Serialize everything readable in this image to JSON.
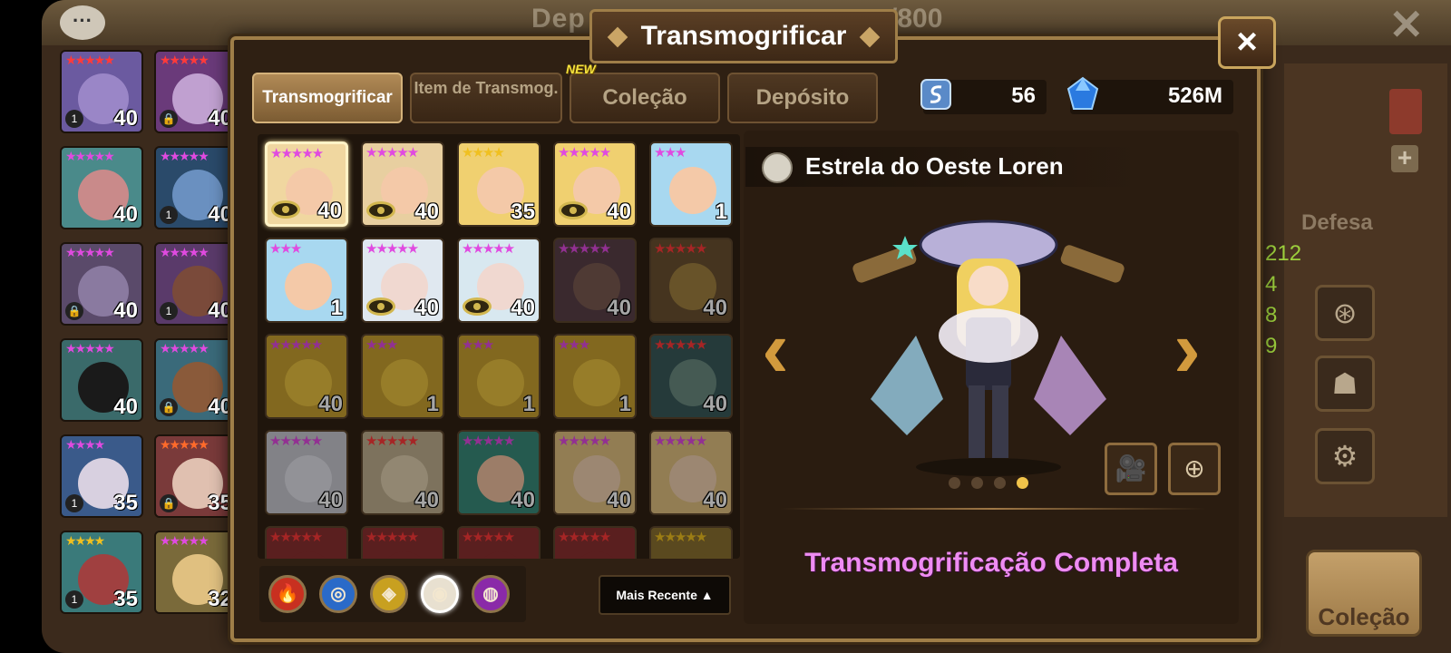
{
  "background": {
    "title_left": "Dep",
    "title_right": "/800",
    "defesa_label": "Defesa",
    "stats": [
      "212",
      "4",
      "8",
      "9"
    ],
    "collection_button": "Coleção",
    "monster_list_left": [
      {
        "stars": "★★★★★",
        "level": "40",
        "badge": "1",
        "color": "#6b5aa0",
        "face": "#9a86c7",
        "star_color": "#ff3a3a"
      },
      {
        "stars": "★★★★★",
        "level": "40",
        "badge": "",
        "color": "#4a8a8a",
        "face": "#c98a8a",
        "star_color": "#e04ae0"
      },
      {
        "stars": "★★★★★",
        "level": "40",
        "badge": "🔒",
        "color": "#5a4a6a",
        "face": "#8a7aa0",
        "star_color": "#e04ae0"
      },
      {
        "stars": "★★★★★",
        "level": "40",
        "badge": "",
        "color": "#3a6a6a",
        "face": "#1a1a1a",
        "star_color": "#e04ae0"
      },
      {
        "stars": "★★★★",
        "level": "35",
        "badge": "1",
        "color": "#3a5a8a",
        "face": "#d8d0e0",
        "star_color": "#e04ae0"
      },
      {
        "stars": "★★★★",
        "level": "35",
        "badge": "1",
        "color": "#3a7a7a",
        "face": "#a04040",
        "star_color": "#f0c020"
      }
    ],
    "monster_list_right": [
      {
        "stars": "★★★★★",
        "level": "40",
        "badge": "🔒",
        "color": "#6a3a7a",
        "face": "#c0a0d0",
        "star_color": "#ff3a3a"
      },
      {
        "stars": "★★★★★",
        "level": "40",
        "badge": "1",
        "color": "#2a4a6a",
        "face": "#6a90c0",
        "star_color": "#e04ae0"
      },
      {
        "stars": "★★★★★",
        "level": "40",
        "badge": "1",
        "color": "#5a3a6a",
        "face": "#7a4a3a",
        "star_color": "#e04ae0"
      },
      {
        "stars": "★★★★★",
        "level": "40",
        "badge": "🔒",
        "color": "#3a6a7a",
        "face": "#8a5a3a",
        "star_color": "#e04ae0"
      },
      {
        "stars": "★★★★★",
        "level": "35",
        "badge": "🔒",
        "color": "#7a3a3a",
        "face": "#e0c0b0",
        "star_color": "#ff6a2a"
      },
      {
        "stars": "★★★★★",
        "level": "32",
        "badge": "",
        "color": "#7a6a3a",
        "face": "#e0c080",
        "star_color": "#e04ae0"
      }
    ]
  },
  "modal": {
    "title": "Transmogrificar",
    "close_label": "×",
    "tabs": [
      {
        "label": "Transmogrificar",
        "active": true
      },
      {
        "label": "Item de Transmog.",
        "active": false
      },
      {
        "label": "Coleção",
        "active": false
      },
      {
        "label": "Depósito",
        "active": false
      }
    ],
    "new_badge": "NEW",
    "currency": [
      {
        "icon": "transmog-stone-icon",
        "value": "56"
      },
      {
        "icon": "crystal-icon",
        "value": "526M"
      }
    ],
    "grid": [
      {
        "stars": "★★★★★",
        "level": "40",
        "eye": true,
        "color": "#f0d7a0",
        "face": "#f4c9a8",
        "star_color": "#e04ae0",
        "selected": true
      },
      {
        "stars": "★★★★★",
        "level": "40",
        "eye": true,
        "color": "#e8cfa0",
        "face": "#f4c9a8",
        "star_color": "#e04ae0"
      },
      {
        "stars": "★★★★",
        "level": "35",
        "eye": false,
        "color": "#f0d070",
        "face": "#f4c9a8",
        "star_color": "#f0c020"
      },
      {
        "stars": "★★★★★",
        "level": "40",
        "eye": true,
        "color": "#f0d070",
        "face": "#f4c9a8",
        "star_color": "#e04ae0"
      },
      {
        "stars": "★★★",
        "level": "1",
        "eye": false,
        "color": "#a8d8f0",
        "face": "#f4c9a8",
        "star_color": "#e04ae0"
      },
      {
        "stars": "★★★",
        "level": "1",
        "eye": false,
        "color": "#a8d8f0",
        "face": "#f4c9a8",
        "star_color": "#e04ae0"
      },
      {
        "stars": "★★★★★",
        "level": "40",
        "eye": true,
        "color": "#e0e8f0",
        "face": "#f0d8d0",
        "star_color": "#e04ae0"
      },
      {
        "stars": "★★★★★",
        "level": "40",
        "eye": true,
        "color": "#d8e8f0",
        "face": "#f0d8d0",
        "star_color": "#e04ae0"
      },
      {
        "stars": "★★★★★",
        "level": "40",
        "eye": false,
        "color": "#5a4048",
        "face": "#7a5a50",
        "star_color": "#e04ae0",
        "dim": true
      },
      {
        "stars": "★★★★★",
        "level": "40",
        "eye": false,
        "color": "#6a5030",
        "face": "#a08040",
        "star_color": "#ff3a3a",
        "dim": true
      },
      {
        "stars": "★★★★★",
        "level": "40",
        "eye": false,
        "color": "#c8a030",
        "face": "#e8c040",
        "star_color": "#e04ae0",
        "dim": true
      },
      {
        "stars": "★★★",
        "level": "1",
        "eye": false,
        "color": "#c8a030",
        "face": "#e8c040",
        "star_color": "#e04ae0",
        "dim": true
      },
      {
        "stars": "★★★",
        "level": "1",
        "eye": false,
        "color": "#c8a030",
        "face": "#e8c040",
        "star_color": "#e04ae0",
        "dim": true
      },
      {
        "stars": "★★★",
        "level": "1",
        "eye": false,
        "color": "#c8a030",
        "face": "#e8c040",
        "star_color": "#e04ae0",
        "dim": true
      },
      {
        "stars": "★★★★★",
        "level": "40",
        "eye": false,
        "color": "#3a5a5a",
        "face": "#6a8a80",
        "star_color": "#ff3a3a",
        "dim": true
      },
      {
        "stars": "★★★★★",
        "level": "40",
        "eye": false,
        "color": "#c8c8d0",
        "face": "#e0e0e8",
        "star_color": "#e04ae0",
        "dim": true
      },
      {
        "stars": "★★★★★",
        "level": "40",
        "eye": false,
        "color": "#c0b090",
        "face": "#e0d0b0",
        "star_color": "#ff3a3a",
        "dim": true
      },
      {
        "stars": "★★★★★",
        "level": "40",
        "eye": false,
        "color": "#3a8a7a",
        "face": "#f0c0a0",
        "star_color": "#e04ae0",
        "dim": true
      },
      {
        "stars": "★★★★★",
        "level": "40",
        "eye": false,
        "color": "#e0c080",
        "face": "#f0d0b0",
        "star_color": "#e04ae0",
        "dim": true
      },
      {
        "stars": "★★★★★",
        "level": "40",
        "eye": false,
        "color": "#e0c080",
        "face": "#f0d0b0",
        "star_color": "#e04ae0",
        "dim": true
      },
      {
        "stars": "★★★★★",
        "level": "",
        "eye": false,
        "color": "#8a3030",
        "face": "#8a3030",
        "star_color": "#ff3a3a",
        "dim": true
      },
      {
        "stars": "★★★★★",
        "level": "",
        "eye": false,
        "color": "#8a3030",
        "face": "#8a3030",
        "star_color": "#ff3a3a",
        "dim": true
      },
      {
        "stars": "★★★★★",
        "level": "",
        "eye": false,
        "color": "#8a3030",
        "face": "#8a3030",
        "star_color": "#ff3a3a",
        "dim": true
      },
      {
        "stars": "★★★★★",
        "level": "",
        "eye": false,
        "color": "#8a3030",
        "face": "#8a3030",
        "star_color": "#ff3a3a",
        "dim": true
      },
      {
        "stars": "★★★★★",
        "level": "",
        "eye": false,
        "color": "#8a7030",
        "face": "#8a7030",
        "star_color": "#f0c020",
        "dim": true
      }
    ],
    "element_filters": [
      {
        "icon": "fire-element-icon",
        "color": "#c83020",
        "glyph": "🔥"
      },
      {
        "icon": "water-element-icon",
        "color": "#2a6ac8",
        "glyph": "◎"
      },
      {
        "icon": "wind-element-icon",
        "color": "#c8a020",
        "glyph": "◈"
      },
      {
        "icon": "light-element-icon",
        "color": "#e8e0d0",
        "glyph": "◉",
        "active": true
      },
      {
        "icon": "dark-element-icon",
        "color": "#8a2aa8",
        "glyph": "◍"
      }
    ],
    "sort_label": "Mais Recente ▲",
    "preview": {
      "character_name": "Estrela do Oeste Loren",
      "status": "Transmogrificação Completa",
      "dots": [
        false,
        false,
        false,
        true
      ]
    }
  }
}
